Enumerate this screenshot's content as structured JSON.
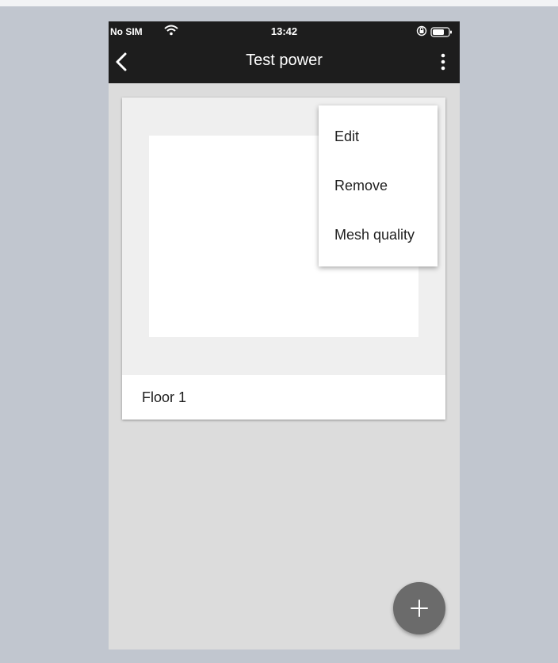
{
  "status_bar": {
    "carrier": "No SIM",
    "time": "13:42",
    "wifi_icon": "wifi-icon",
    "rotation_lock_icon": "rotation-lock-icon",
    "battery_icon": "battery-icon"
  },
  "app_bar": {
    "title": "Test power",
    "back_icon": "chevron-left-icon",
    "more_icon": "more-vertical-icon"
  },
  "floors": [
    {
      "name": "Floor 1"
    }
  ],
  "popup_menu": {
    "items": [
      {
        "label": "Edit"
      },
      {
        "label": "Remove"
      },
      {
        "label": "Mesh quality"
      }
    ]
  },
  "fab": {
    "icon": "plus-icon"
  },
  "colors": {
    "page_background": "#c1c6cf",
    "app_bar": "#1d1d1d",
    "screen_background": "#dcdcdc",
    "card_preview": "#efefef",
    "fab": "#6b6b6b"
  }
}
